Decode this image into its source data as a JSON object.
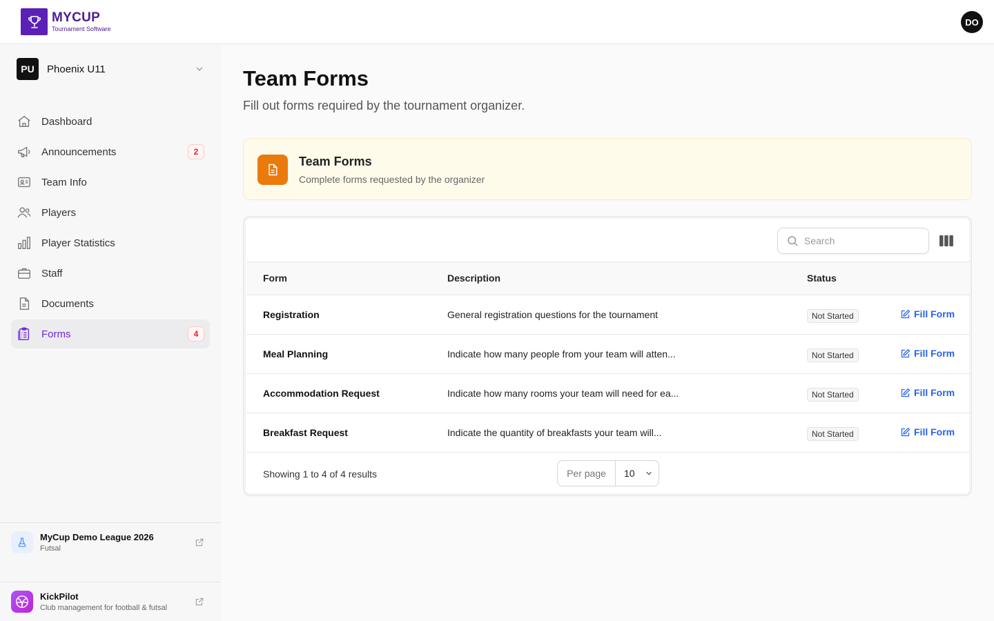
{
  "brand": {
    "name": "MYCUP",
    "tagline": "Tournament Software",
    "color": "#5b21b6"
  },
  "user": {
    "initials": "DO"
  },
  "team": {
    "initials": "PU",
    "name": "Phoenix U11"
  },
  "nav": [
    {
      "label": "Dashboard",
      "icon": "home-icon"
    },
    {
      "label": "Announcements",
      "icon": "megaphone-icon",
      "badge": "2"
    },
    {
      "label": "Team Info",
      "icon": "id-card-icon"
    },
    {
      "label": "Players",
      "icon": "users-icon"
    },
    {
      "label": "Player Statistics",
      "icon": "bar-chart-icon"
    },
    {
      "label": "Staff",
      "icon": "briefcase-icon"
    },
    {
      "label": "Documents",
      "icon": "document-icon"
    },
    {
      "label": "Forms",
      "icon": "clipboard-icon",
      "badge": "4",
      "active": true
    }
  ],
  "league": {
    "title": "MyCup Demo League 2026",
    "sub": "Futsal"
  },
  "promo": {
    "title": "KickPilot",
    "sub": "Club management for football & futsal"
  },
  "page": {
    "title": "Team Forms",
    "subtitle": "Fill out forms required by the tournament organizer."
  },
  "banner": {
    "title": "Team Forms",
    "subtitle": "Complete forms requested by the organizer",
    "accent": "#ea7a0c"
  },
  "search": {
    "placeholder": "Search",
    "value": ""
  },
  "table": {
    "headers": {
      "form": "Form",
      "description": "Description",
      "status": "Status"
    },
    "action_label": "Fill Form",
    "rows": [
      {
        "form": "Registration",
        "description": "General registration questions for the tournament",
        "status": "Not Started"
      },
      {
        "form": "Meal Planning",
        "description": "Indicate how many people from your team will atten...",
        "status": "Not Started"
      },
      {
        "form": "Accommodation Request",
        "description": "Indicate how many rooms your team will need for ea...",
        "status": "Not Started"
      },
      {
        "form": "Breakfast Request",
        "description": "Indicate the quantity of breakfasts your team will...",
        "status": "Not Started"
      }
    ],
    "summary": "Showing 1 to 4 of 4 results",
    "per_page_label": "Per page",
    "per_page_value": "10"
  }
}
